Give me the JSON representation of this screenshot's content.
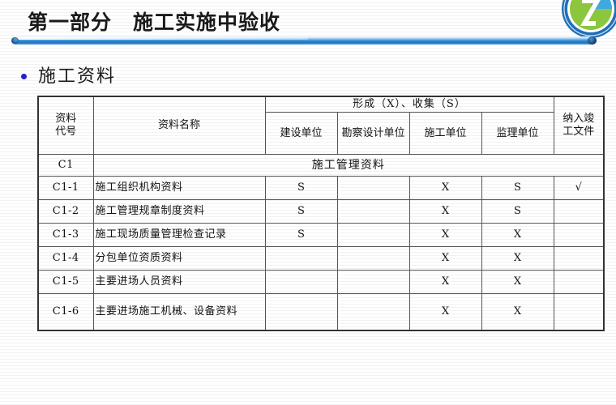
{
  "slide": {
    "title": "第一部分　施工实施中验收",
    "bullet_text": "施工资料",
    "bullet_icon": "bullet-dot-icon",
    "logo_icon": "circular-company-logo-icon",
    "accent_color": "#1f74c0",
    "bullet_color": "#2222cc"
  },
  "table": {
    "header": {
      "code_label": "资料\n代号",
      "code_line1": "资料",
      "code_line2": "代号",
      "name_label": "资料名称",
      "group_label": "形成（X）、收集（S）",
      "units": [
        "建设单位",
        "勘察设计单位",
        "施工单位",
        "监理单位"
      ],
      "final_label_line1": "纳入竣",
      "final_label_line2": "工文件",
      "final_label": "纳入竣工文件"
    },
    "section_row": {
      "code": "C1",
      "title": "施工管理资料"
    },
    "rows": [
      {
        "code": "C1-1",
        "name": "施工组织机构资料",
        "marks": [
          "S",
          "",
          "X",
          "S"
        ],
        "final": "√",
        "tall": false
      },
      {
        "code": "C1-2",
        "name": "施工管理规章制度资料",
        "marks": [
          "S",
          "",
          "X",
          "S"
        ],
        "final": "",
        "tall": false
      },
      {
        "code": "C1-3",
        "name": "施工现场质量管理检查记录",
        "marks": [
          "S",
          "",
          "X",
          "X"
        ],
        "final": "",
        "tall": false
      },
      {
        "code": "C1-4",
        "name": "分包单位资质资料",
        "marks": [
          "",
          "",
          "X",
          "X"
        ],
        "final": "",
        "tall": false
      },
      {
        "code": "C1-5",
        "name": "主要进场人员资料",
        "marks": [
          "",
          "",
          "X",
          "X"
        ],
        "final": "",
        "tall": false
      },
      {
        "code": "C1-6",
        "name": "主要进场施工机械、设备资料",
        "marks": [
          "",
          "",
          "X",
          "X"
        ],
        "final": "",
        "tall": true
      }
    ]
  }
}
